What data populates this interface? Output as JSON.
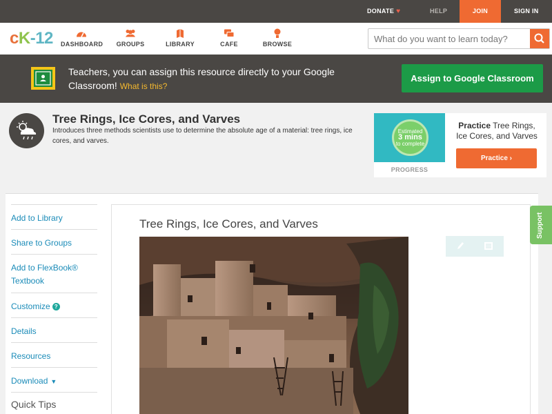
{
  "topbar": {
    "donate": "DONATE",
    "help": "HELP",
    "join": "JOIN",
    "signin": "SIGN IN"
  },
  "brand": {
    "logo_c": "c",
    "logo_k": "K",
    "logo_rest": "-12"
  },
  "nav": {
    "items": [
      {
        "label": "DASHBOARD",
        "icon": "dashboard-icon"
      },
      {
        "label": "GROUPS",
        "icon": "groups-icon"
      },
      {
        "label": "LIBRARY",
        "icon": "library-icon"
      },
      {
        "label": "CAFE",
        "icon": "cafe-icon"
      },
      {
        "label": "BROWSE",
        "icon": "browse-icon"
      }
    ],
    "search_placeholder": "What do you want to learn today?"
  },
  "classroom": {
    "text": "Teachers, you can assign this resource directly to your Google Classroom!",
    "what_link": "What is this?",
    "button": "Assign to Google Classroom"
  },
  "lesson": {
    "title": "Tree Rings, Ice Cores, and Varves",
    "description": "Introduces three methods scientists use to determine the absolute age of a material: tree rings, ice cores, and varves."
  },
  "practice": {
    "estimated": "Estimated",
    "mins": "3 mins",
    "to_complete": "to complete",
    "progress_label": "PROGRESS",
    "title_bold": "Practice",
    "title_rest": "Tree Rings, Ice Cores, and Varves",
    "button": "Practice"
  },
  "sidebar": {
    "items": [
      {
        "label": "Add to Library"
      },
      {
        "label": "Share to Groups"
      },
      {
        "label": "Add to FlexBook®\nTextbook"
      },
      {
        "label": "Customize"
      },
      {
        "label": "Details"
      },
      {
        "label": "Resources"
      },
      {
        "label": "Download"
      }
    ],
    "quick_tips": "Quick Tips"
  },
  "article": {
    "title": "Tree Rings, Ice Cores, and Varves"
  },
  "support": "Support",
  "colors": {
    "accent": "#ef6a32",
    "green": "#1c9b47",
    "link": "#1a8bb8",
    "dark": "#4a4744"
  }
}
